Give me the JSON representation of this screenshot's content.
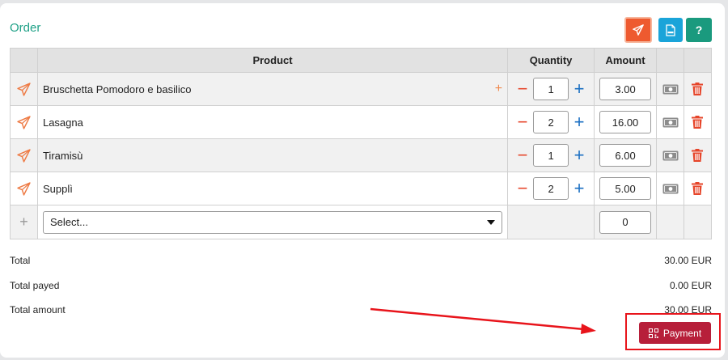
{
  "header": {
    "title": "Order",
    "help_label": "?",
    "pdf_label": "PDF"
  },
  "table": {
    "columns": [
      "Product",
      "Quantity",
      "Amount"
    ],
    "rows": [
      {
        "product": "Bruschetta Pomodoro e basilico",
        "qty": "1",
        "amount": "3.00",
        "has_add": true
      },
      {
        "product": "Lasagna",
        "qty": "2",
        "amount": "16.00",
        "has_add": false
      },
      {
        "product": "Tiramisù",
        "qty": "1",
        "amount": "6.00",
        "has_add": false
      },
      {
        "product": "Supplì",
        "qty": "2",
        "amount": "5.00",
        "has_add": false
      }
    ],
    "add_plus": "+",
    "new_row": {
      "select_placeholder": "Select...",
      "amount": "0",
      "plus": "+"
    }
  },
  "summary": {
    "total_label": "Total",
    "total_value": "30.00 EUR",
    "payed_label": "Total payed",
    "payed_value": "0.00 EUR",
    "amount_label": "Total amount",
    "amount_value": "30.00 EUR"
  },
  "payment_button": {
    "label": "Payment"
  },
  "colors": {
    "title": "#1fa187",
    "send": "#ee5a2f",
    "pdf": "#1aa4d9",
    "help": "#1a9a7e",
    "minus": "#e6452a",
    "plus": "#1b6fc2",
    "delete": "#e6452a",
    "payment": "#b71f3a",
    "annotation": "#e8141b"
  }
}
